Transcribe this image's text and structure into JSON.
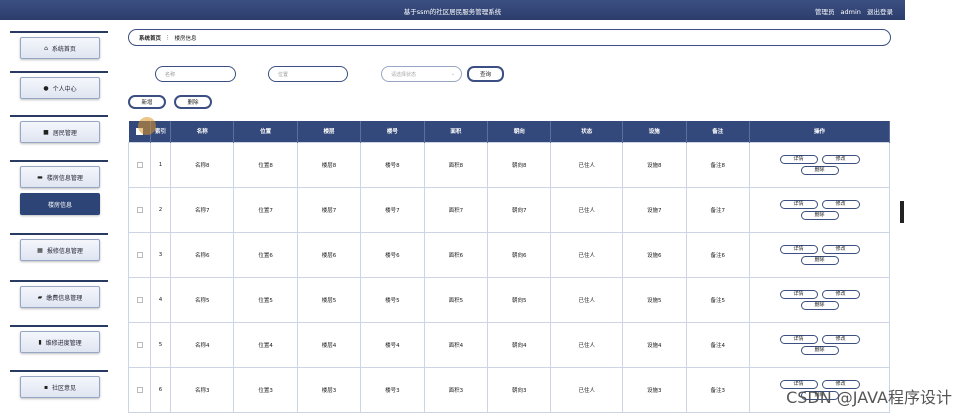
{
  "header": {
    "title": "基于ssm的社区居民服务管理系统",
    "role": "管理员",
    "user": "admin",
    "logout": "退出登录"
  },
  "sidebar": {
    "items": [
      {
        "label": "系统首页",
        "icon": "home-icon",
        "glyph": "⌂"
      },
      {
        "label": "个人中心",
        "icon": "user-icon",
        "glyph": "●"
      },
      {
        "label": "居民管理",
        "icon": "list-icon",
        "glyph": "■"
      },
      {
        "label": "楼房信息管理",
        "icon": "building-icon",
        "glyph": "▬"
      },
      {
        "label": "楼房信息",
        "icon": "",
        "glyph": ""
      },
      {
        "label": "报修信息管理",
        "icon": "grid-icon",
        "glyph": "▦"
      },
      {
        "label": "缴费信息管理",
        "icon": "wallet-icon",
        "glyph": "▰"
      },
      {
        "label": "维修进度管理",
        "icon": "chart-icon",
        "glyph": "▮"
      },
      {
        "label": "社区意见",
        "icon": "apps-icon",
        "glyph": "▪"
      }
    ]
  },
  "breadcrumb": {
    "home": "系统首页",
    "sep": "⋮",
    "current": "楼房信息"
  },
  "search": {
    "name_placeholder": "名称",
    "location_placeholder": "位置",
    "status_placeholder": "请选择状态",
    "button": "查询"
  },
  "toolbar": {
    "add": "新增",
    "delete": "删除"
  },
  "table": {
    "columns": [
      "索引",
      "名称",
      "位置",
      "楼层",
      "楼号",
      "面积",
      "朝向",
      "状态",
      "设施",
      "备注",
      "操作"
    ],
    "rows": [
      [
        "1",
        "名称8",
        "位置8",
        "楼层8",
        "楼号8",
        "面积8",
        "朝向8",
        "已住人",
        "设施8",
        "备注8"
      ],
      [
        "2",
        "名称7",
        "位置7",
        "楼层7",
        "楼号7",
        "面积7",
        "朝向7",
        "已住人",
        "设施7",
        "备注7"
      ],
      [
        "3",
        "名称6",
        "位置6",
        "楼层6",
        "楼号6",
        "面积6",
        "朝向6",
        "已住人",
        "设施6",
        "备注6"
      ],
      [
        "4",
        "名称5",
        "位置5",
        "楼层5",
        "楼号5",
        "面积5",
        "朝向5",
        "已住人",
        "设施5",
        "备注5"
      ],
      [
        "5",
        "名称4",
        "位置4",
        "楼层4",
        "楼号4",
        "面积4",
        "朝向4",
        "已住人",
        "设施4",
        "备注4"
      ],
      [
        "6",
        "名称3",
        "位置3",
        "楼层3",
        "楼号3",
        "面积3",
        "朝向3",
        "已住人",
        "设施3",
        "备注3"
      ]
    ],
    "ops": {
      "detail": "详情",
      "edit": "修改",
      "delete": "删除"
    }
  },
  "watermark": "CSDN @JAVA程序设计",
  "colors": {
    "primary": "#34497b",
    "header": "#2b3d6b"
  }
}
